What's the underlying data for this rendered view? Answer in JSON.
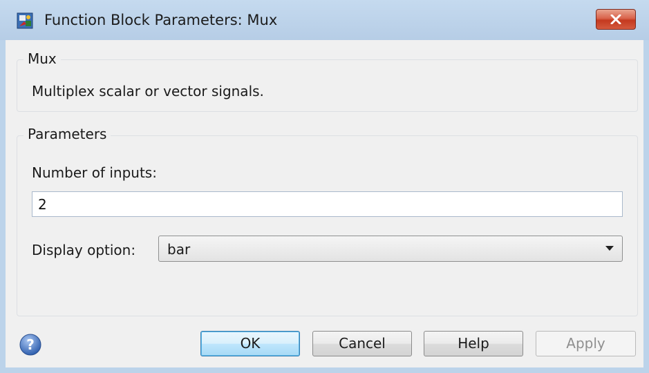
{
  "window": {
    "title": "Function Block Parameters: Mux",
    "close_icon": "close-icon",
    "app_icon": "simulink-block-icon"
  },
  "description_group": {
    "title": "Mux",
    "text": "Multiplex scalar or vector signals."
  },
  "parameters_group": {
    "title": "Parameters",
    "number_of_inputs_label": "Number of inputs:",
    "number_of_inputs_value": "2",
    "display_option_label": "Display option:",
    "display_option_value": "bar"
  },
  "footer": {
    "help_icon": "help-icon",
    "ok_label": "OK",
    "cancel_label": "Cancel",
    "help_label": "Help",
    "apply_label": "Apply"
  },
  "colors": {
    "titlebar": "#bcd3ea",
    "close_button": "#c4391f",
    "client_bg": "#f0f0f0",
    "default_button_border": "#3c7fb1"
  }
}
